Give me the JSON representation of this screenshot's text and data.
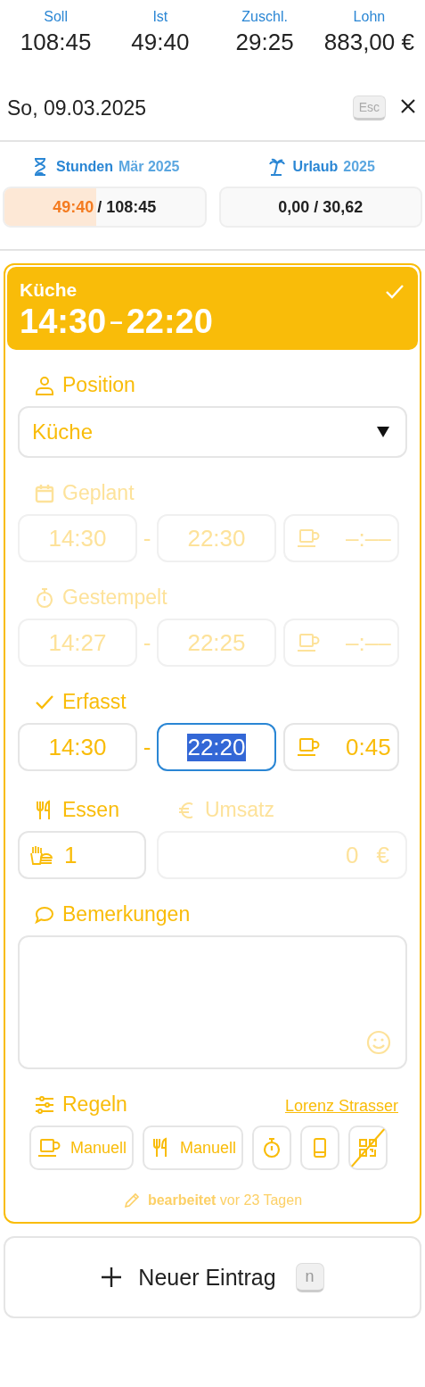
{
  "summary": [
    {
      "label": "Soll",
      "value": "108:45"
    },
    {
      "label": "Ist",
      "value": "49:40"
    },
    {
      "label": "Zuschl.",
      "value": "29:25"
    },
    {
      "label": "Lohn",
      "value": "883,00 €"
    }
  ],
  "date": "So, 09.03.2025",
  "esc_key": "Esc",
  "hours": {
    "label": "Stunden",
    "period": "Mär 2025",
    "value": "49:40",
    "total": "/ 108:45",
    "level": 0.457
  },
  "vacation": {
    "label": "Urlaub",
    "period": "2025",
    "value": "0,00 / 30,62"
  },
  "entry": {
    "title": "Küche",
    "start": "14:30",
    "dash": "–",
    "end": "22:20",
    "confirmed": true,
    "position_label": "Position",
    "position_value": "Küche",
    "time_rows": [
      {
        "kind": "planned",
        "label": "Geplant",
        "start": "14:30",
        "sep": "-",
        "end": "22:30",
        "break": "–:––",
        "active": false,
        "end_focused": false
      },
      {
        "kind": "stamped",
        "label": "Gestempelt",
        "start": "14:27",
        "sep": "-",
        "end": "22:25",
        "break": "–:––",
        "active": false,
        "end_focused": false
      },
      {
        "kind": "recorded",
        "label": "Erfasst",
        "start": "14:30",
        "sep": "-",
        "end": "22:20",
        "break": "0:45",
        "active": true,
        "end_focused": true
      }
    ],
    "meals": {
      "label": "Essen",
      "value": "1"
    },
    "revenue": {
      "label": "Umsatz",
      "value": "0",
      "currency": "€",
      "disabled": true
    },
    "comments_label": "Bemerkungen",
    "rules_label": "Regeln",
    "user": "Lorenz Strasser",
    "rules": [
      {
        "kind": "break",
        "label": "Manuell"
      },
      {
        "kind": "meal",
        "label": "Manuell"
      },
      {
        "kind": "stopwatch"
      },
      {
        "kind": "phone"
      },
      {
        "kind": "qr",
        "crossed": true
      }
    ],
    "edited": "**bearbeitet** vor 23 Tagen"
  },
  "new_entry": {
    "label": "Neuer Eintrag",
    "key": "n"
  }
}
